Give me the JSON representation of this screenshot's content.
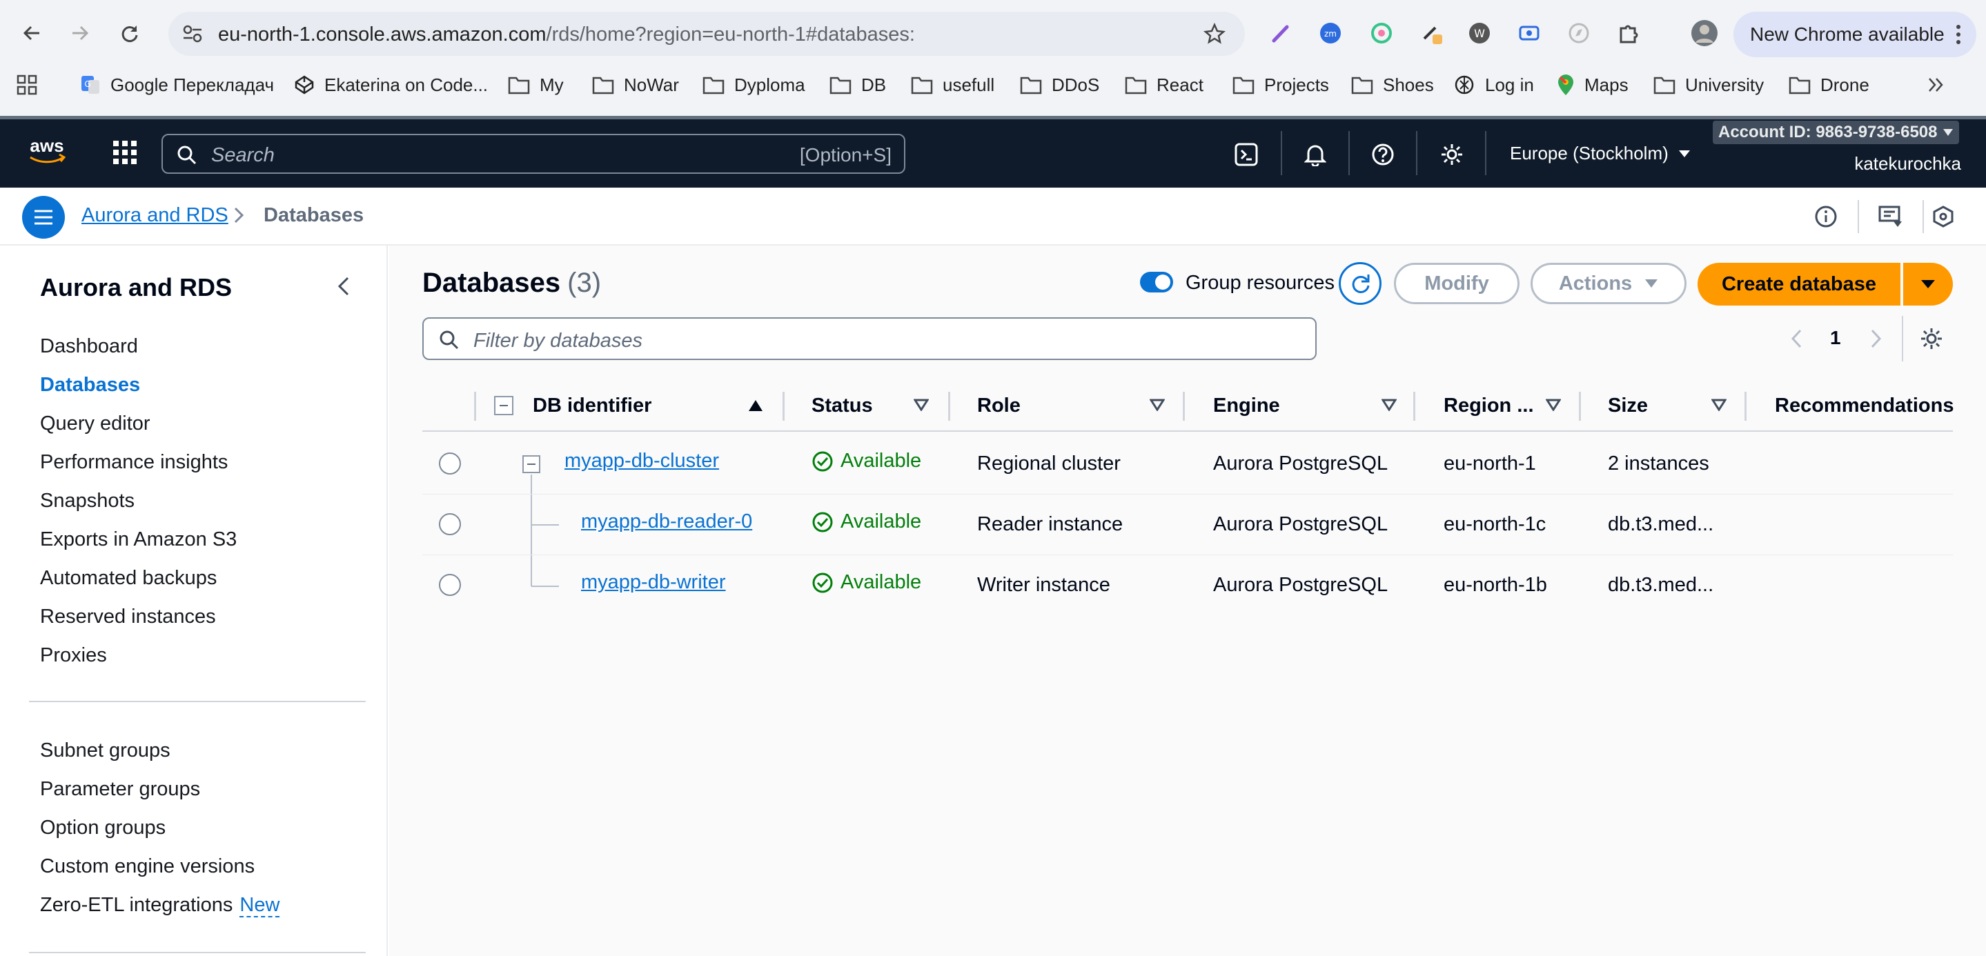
{
  "browser": {
    "url_host": "eu-north-1.console.aws.amazon.com",
    "url_path": "/rds/home?region=eu-north-1#databases:",
    "update_button": "New Chrome available",
    "bookmarks": [
      "Google Перекладач",
      "Ekaterina on Code...",
      "My",
      "NoWar",
      "Dyploma",
      "DB",
      "usefull",
      "DDoS",
      "React",
      "Projects",
      "Shoes",
      "Log in",
      "Maps",
      "University",
      "Drone"
    ]
  },
  "aws_nav": {
    "search_placeholder": "Search",
    "search_shortcut": "[Option+S]",
    "region": "Europe (Stockholm)",
    "account": "Account ID: 9863-9738-6508",
    "user": "katekurochka"
  },
  "breadcrumb": {
    "parent": "Aurora and RDS",
    "current": "Databases"
  },
  "sidebar": {
    "title": "Aurora and RDS",
    "items": [
      "Dashboard",
      "Databases",
      "Query editor",
      "Performance insights",
      "Snapshots",
      "Exports in Amazon S3",
      "Automated backups",
      "Reserved instances",
      "Proxies"
    ],
    "items2": [
      "Subnet groups",
      "Parameter groups",
      "Option groups",
      "Custom engine versions",
      "Zero-ETL integrations"
    ],
    "new_badge": "New",
    "active": "Databases"
  },
  "main": {
    "title": "Databases",
    "count": "(3)",
    "group_toggle_label": "Group resources",
    "modify_label": "Modify",
    "actions_label": "Actions",
    "create_label": "Create database",
    "filter_placeholder": "Filter by databases",
    "page": "1",
    "columns": [
      "DB identifier",
      "Status",
      "Role",
      "Engine",
      "Region ...",
      "Size",
      "Recommendations"
    ],
    "rows": [
      {
        "id": "myapp-db-cluster",
        "status": "Available",
        "role": "Regional cluster",
        "engine": "Aurora PostgreSQL",
        "region": "eu-north-1",
        "size": "2 instances"
      },
      {
        "id": "myapp-db-reader-0",
        "status": "Available",
        "role": "Reader instance",
        "engine": "Aurora PostgreSQL",
        "region": "eu-north-1c",
        "size": "db.t3.med..."
      },
      {
        "id": "myapp-db-writer",
        "status": "Available",
        "role": "Writer instance",
        "engine": "Aurora PostgreSQL",
        "region": "eu-north-1b",
        "size": "db.t3.med..."
      }
    ]
  },
  "colors": {
    "aws_nav_bg": "#0f1b2a",
    "link_blue": "#0972d3",
    "primary_orange": "#ff9900",
    "status_green": "#037f0c"
  }
}
